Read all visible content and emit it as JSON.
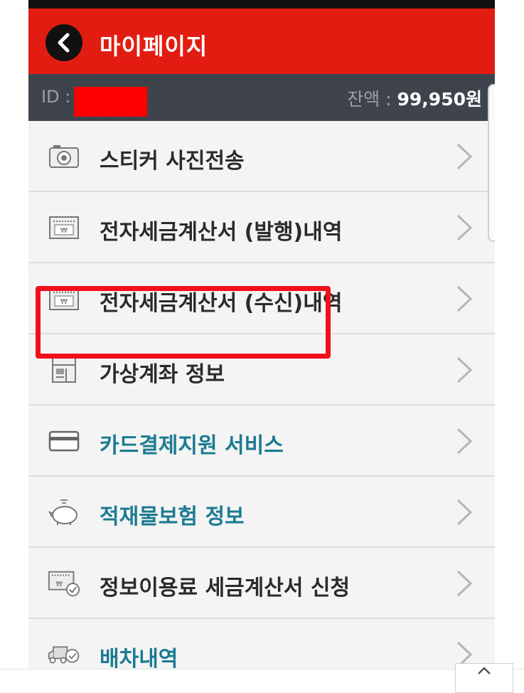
{
  "header": {
    "title": "마이페이지",
    "back_icon": "chevron-left-icon"
  },
  "info": {
    "id_label": "ID :",
    "balance_label": "잔액 :",
    "balance_value": "99,950원"
  },
  "menu": {
    "items": [
      {
        "label": "스티커 사진전송",
        "icon": "camera-icon",
        "style": "default"
      },
      {
        "label": "전자세금계산서 (발행)내역",
        "icon": "invoice-icon",
        "style": "default"
      },
      {
        "label": "전자세금계산서 (수신)내역",
        "icon": "invoice-icon",
        "style": "default"
      },
      {
        "label": "가상계좌 정보",
        "icon": "account-icon",
        "style": "default"
      },
      {
        "label": "카드결제지원 서비스",
        "icon": "credit-card-icon",
        "style": "teal",
        "highlighted": true
      },
      {
        "label": "적재물보험 정보",
        "icon": "piggy-bank-icon",
        "style": "teal"
      },
      {
        "label": "정보이용료 세금계산서 신청",
        "icon": "invoice-check-icon",
        "style": "default"
      },
      {
        "label": "배차내역",
        "icon": "truck-check-icon",
        "style": "teal"
      }
    ]
  },
  "colors": {
    "appbar": "#e31c12",
    "infobar": "#3a4048",
    "teal_label": "#1b7b91",
    "highlight": "#f0101a"
  }
}
